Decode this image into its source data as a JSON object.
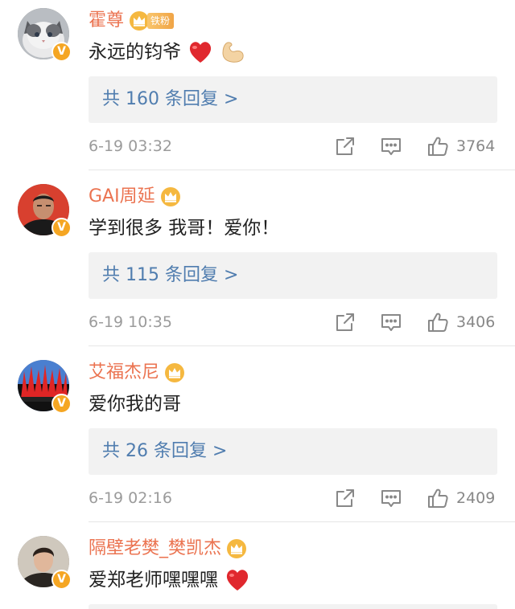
{
  "comments": [
    {
      "username": "霍尊",
      "fan_tag": "铁粉",
      "text": "永远的钧爷",
      "emojis": [
        "red-heart",
        "flexed-biceps"
      ],
      "reply_summary": "共 160 条回复 >",
      "timestamp": "6-19 03:32",
      "like_count": "3764",
      "avatar_icon": "cat-avatar",
      "badge": "V"
    },
    {
      "username": "GAI周延",
      "text": "学到很多 我哥！爱你！",
      "emojis": [],
      "reply_summary": "共 115 条回复 >",
      "timestamp": "6-19 10:35",
      "like_count": "3406",
      "avatar_icon": "man-portrait-avatar",
      "badge": "V"
    },
    {
      "username": "艾福杰尼",
      "text": "爱你我的哥",
      "emojis": [],
      "reply_summary": "共 26 条回复 >",
      "timestamp": "6-19 02:16",
      "like_count": "2409",
      "avatar_icon": "red-flame-avatar",
      "badge": "V"
    },
    {
      "username": "隔壁老樊_樊凯杰",
      "text": "爱郑老师嘿嘿嘿",
      "emojis": [
        "red-heart"
      ],
      "avatar_icon": "young-man-avatar",
      "badge": "V"
    }
  ],
  "colors": {
    "username": "#eb7350",
    "reply_link": "#507daf",
    "meta_text": "#9b9b9b",
    "reply_bg": "#f2f2f2",
    "badge": "#f5a623"
  },
  "icons": {
    "share": "share-icon",
    "comment": "comment-icon",
    "like": "thumbs-up-icon",
    "crown": "crown-member-icon"
  }
}
